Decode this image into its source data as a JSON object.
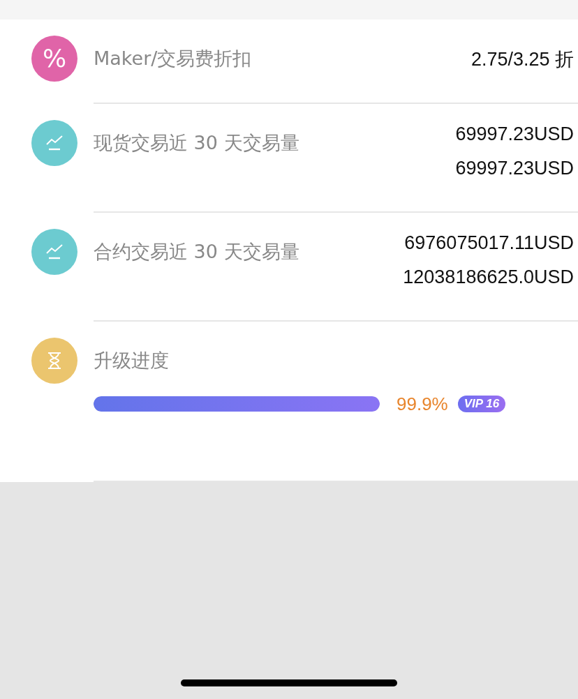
{
  "rows": [
    {
      "kind": "percent",
      "color": "#e064a8",
      "icon_glyph": "%",
      "label": "Maker/交易费折扣",
      "values": [
        "2.75/3.25 折"
      ]
    },
    {
      "kind": "chart",
      "color": "#6ccbd0",
      "label": "现货交易近 30 天交易量",
      "values": [
        "69997.23USD",
        "69997.23USD"
      ]
    },
    {
      "kind": "chart",
      "color": "#6ccbd0",
      "label": "合约交易近 30 天交易量",
      "values": [
        "6976075017.11USD",
        "12038186625.0USD"
      ]
    },
    {
      "kind": "progress",
      "color": "#ebc56e",
      "label": "升级进度",
      "level": 0.999,
      "percent": "99.9%",
      "badge": "VIP 16"
    }
  ]
}
